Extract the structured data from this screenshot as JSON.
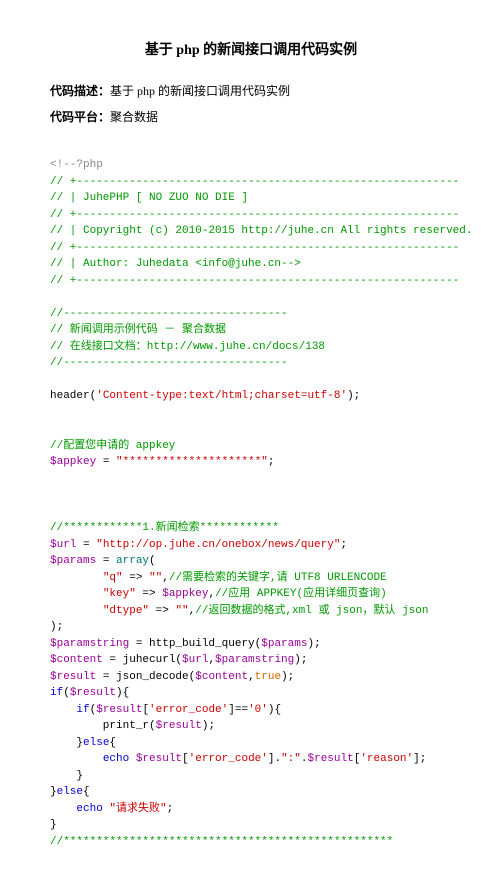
{
  "title": "基于 php 的新闻接口调用代码实例",
  "meta": {
    "desc_label": "代码描述：",
    "desc_value": "基于 php 的新闻接口调用代码实例",
    "platform_label": "代码平台：",
    "platform_value": "聚合数据"
  },
  "code": {
    "l01": "<!--?php",
    "l02": "// +----------------------------------------------------------",
    "l03": "// | JuhePHP [ NO ZUO NO DIE ]",
    "l04": "// +----------------------------------------------------------",
    "l05": "// | Copyright (c) 2010-2015 http://juhe.cn All rights reserved.",
    "l06": "// +----------------------------------------------------------",
    "l07": "// | Author: Juhedata <info@juhe.cn-->",
    "l08": "// +----------------------------------------------------------",
    "l09": "",
    "l10": "//----------------------------------",
    "l11": "// 新闻调用示例代码 － 聚合数据",
    "l12": "// 在线接口文档：http://www.juhe.cn/docs/138",
    "l13": "//----------------------------------",
    "l14": "",
    "l15a": "header(",
    "l15b": "'Content-type:text/html;charset=utf-8'",
    "l15c": ");",
    "l16": "",
    "l17": "",
    "l18": "//配置您申请的 appkey",
    "l19a": "$appkey",
    "l19b": " = ",
    "l19c": "\"*********************\"",
    "l19d": ";",
    "l20": "",
    "l21": "",
    "l22": "",
    "l23": "//************1.新闻检索************",
    "l24a": "$url",
    "l24b": " = ",
    "l24c": "\"http://op.juhe.cn/onebox/news/query\"",
    "l24d": ";",
    "l25a": "$params",
    "l25b": " = ",
    "l25c": "array",
    "l25d": "(",
    "l26a": "        ",
    "l26b": "\"q\"",
    "l26c": " => ",
    "l26d": "\"\"",
    "l26e": ",",
    "l26f": "//需要检索的关键字,请 UTF8 URLENCODE",
    "l27a": "        ",
    "l27b": "\"key\"",
    "l27c": " => ",
    "l27d": "$appkey",
    "l27e": ",",
    "l27f": "//应用 APPKEY(应用详细页查询)",
    "l28a": "        ",
    "l28b": "\"dtype\"",
    "l28c": " => ",
    "l28d": "\"\"",
    "l28e": ",",
    "l28f": "//返回数据的格式,xml 或 json，默认 json",
    "l29": ");",
    "l30a": "$paramstring",
    "l30b": " = http_build_query(",
    "l30c": "$params",
    "l30d": ");",
    "l31a": "$content",
    "l31b": " = juhecurl(",
    "l31c": "$url",
    "l31d": ",",
    "l31e": "$paramstring",
    "l31f": ");",
    "l32a": "$result",
    "l32b": " = json_decode(",
    "l32c": "$content",
    "l32d": ",",
    "l32e": "true",
    "l32f": ");",
    "l33a": "if",
    "l33b": "(",
    "l33c": "$result",
    "l33d": "){",
    "l34a": "    ",
    "l34b": "if",
    "l34c": "(",
    "l34d": "$result",
    "l34e": "[",
    "l34f": "'error_code'",
    "l34g": "]==",
    "l34h": "'0'",
    "l34i": "){",
    "l35a": "        print_r(",
    "l35b": "$result",
    "l35c": ");",
    "l36a": "    }",
    "l36b": "else",
    "l36c": "{",
    "l37a": "        ",
    "l37b": "echo",
    "l37c": " ",
    "l37d": "$result",
    "l37e": "[",
    "l37f": "'error_code'",
    "l37g": "].",
    "l37h": "\":\"",
    "l37i": ".",
    "l37j": "$result",
    "l37k": "[",
    "l37l": "'reason'",
    "l37m": "];",
    "l38": "    }",
    "l39a": "}",
    "l39b": "else",
    "l39c": "{",
    "l40a": "    ",
    "l40b": "echo",
    "l40c": " ",
    "l40d": "\"请求失败\"",
    "l40e": ";",
    "l41": "}",
    "l42": "//**************************************************"
  }
}
